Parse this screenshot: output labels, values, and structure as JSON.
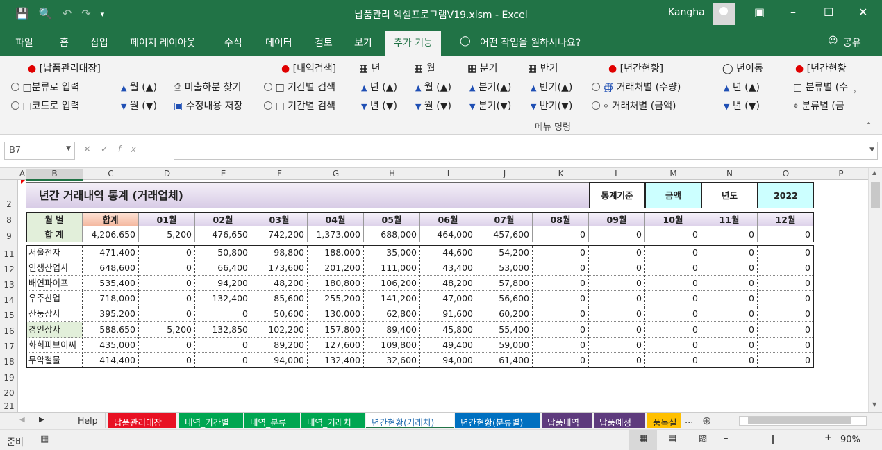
{
  "window": {
    "title": "납품관리 엑셀프로그램V19.xlsm  -  Excel",
    "user": "Kangha"
  },
  "tabs": [
    "파일",
    "홈",
    "삽입",
    "페이지 레이아웃",
    "수식",
    "데이터",
    "검토",
    "보기",
    "추가 기능"
  ],
  "tellme": "어떤 작업을 원하시나요?",
  "share": "공유",
  "ribbon": {
    "r1": [
      "[납품관리대장]",
      "[내역검색]",
      "년",
      "월",
      "분기",
      "반기",
      "[년간현황]",
      "년이동",
      "[년간현황"
    ],
    "r2": [
      "분류로 입력",
      "월 (▲)",
      "미출하분 찾기",
      "기간별 검색",
      "년 (▲)",
      "월 (▲)",
      "분기(▲)",
      "반기(▲)",
      "거래처별 (수량)",
      "년 (▲)",
      "분류별 (수"
    ],
    "r3": [
      "코드로 입력",
      "월 (▼)",
      "수정내용 저장",
      "기간별 검색",
      "년 (▼)",
      "월 (▼)",
      "분기(▼)",
      "반기(▼)",
      "거래처별 (금액)",
      "년 (▼)",
      "분류별 (금"
    ],
    "group": "메뉴 명령"
  },
  "namebox": "B7",
  "columns": [
    "A",
    "B",
    "C",
    "D",
    "E",
    "F",
    "G",
    "H",
    "I",
    "J",
    "K",
    "L",
    "M",
    "N",
    "O",
    "P"
  ],
  "rows": [
    "2",
    "8",
    "9",
    "11",
    "12",
    "13",
    "14",
    "15",
    "16",
    "17",
    "18",
    "19",
    "20",
    "21"
  ],
  "sheet": {
    "title": "년간 거래내역 통계 (거래업체)",
    "basis_label": "통계기준",
    "basis_value": "금액",
    "year_label": "년도",
    "year_value": "2022",
    "header": [
      "월  별",
      "합계",
      "01월",
      "02월",
      "03월",
      "04월",
      "05월",
      "06월",
      "07월",
      "08월",
      "09월",
      "10월",
      "11월",
      "12월"
    ],
    "total": [
      "합  계",
      "4,206,650",
      "5,200",
      "476,650",
      "742,200",
      "1,373,000",
      "688,000",
      "464,000",
      "457,600",
      "0",
      "0",
      "0",
      "0",
      "0"
    ],
    "data": [
      [
        "서울전자",
        "471,400",
        "0",
        "50,800",
        "98,800",
        "188,000",
        "35,000",
        "44,600",
        "54,200",
        "0",
        "0",
        "0",
        "0",
        "0"
      ],
      [
        "인생산업사",
        "648,600",
        "0",
        "66,400",
        "173,600",
        "201,200",
        "111,000",
        "43,400",
        "53,000",
        "0",
        "0",
        "0",
        "0",
        "0"
      ],
      [
        "배연파이프",
        "535,400",
        "0",
        "94,200",
        "48,200",
        "180,800",
        "106,200",
        "48,200",
        "57,800",
        "0",
        "0",
        "0",
        "0",
        "0"
      ],
      [
        "우주산업",
        "718,000",
        "0",
        "132,400",
        "85,600",
        "255,200",
        "141,200",
        "47,000",
        "56,600",
        "0",
        "0",
        "0",
        "0",
        "0"
      ],
      [
        "산둥상사",
        "395,200",
        "0",
        "0",
        "50,600",
        "130,000",
        "62,800",
        "91,600",
        "60,200",
        "0",
        "0",
        "0",
        "0",
        "0"
      ],
      [
        "경인상사",
        "588,650",
        "5,200",
        "132,850",
        "102,200",
        "157,800",
        "89,400",
        "45,800",
        "55,400",
        "0",
        "0",
        "0",
        "0",
        "0"
      ],
      [
        "화희피브이씨",
        "435,000",
        "0",
        "0",
        "89,200",
        "127,600",
        "109,800",
        "49,400",
        "59,000",
        "0",
        "0",
        "0",
        "0",
        "0"
      ],
      [
        "무악철물",
        "414,400",
        "0",
        "0",
        "94,000",
        "132,400",
        "32,600",
        "94,000",
        "61,400",
        "0",
        "0",
        "0",
        "0",
        "0"
      ]
    ]
  },
  "sheet_tabs": [
    {
      "label": "Help",
      "color": "#f0f0f0",
      "fg": "#333"
    },
    {
      "label": "납품관리대장",
      "color": "#e81123",
      "fg": "#fff"
    },
    {
      "label": "내역_기간별",
      "color": "#00a651",
      "fg": "#fff"
    },
    {
      "label": "내역_분류",
      "color": "#00a651",
      "fg": "#fff"
    },
    {
      "label": "내역_거래처",
      "color": "#00a651",
      "fg": "#fff"
    },
    {
      "label": "년간현황(거래처)",
      "color": "#ffffff",
      "fg": "#1f6bb0"
    },
    {
      "label": "년간현황(분류별)",
      "color": "#0070c0",
      "fg": "#fff"
    },
    {
      "label": "납품내역",
      "color": "#5e3b7d",
      "fg": "#fff"
    },
    {
      "label": "납품예정",
      "color": "#5e3b7d",
      "fg": "#fff"
    },
    {
      "label": "품목실",
      "color": "#ffc000",
      "fg": "#222"
    }
  ],
  "status": {
    "ready": "준비",
    "zoom": "90%"
  }
}
